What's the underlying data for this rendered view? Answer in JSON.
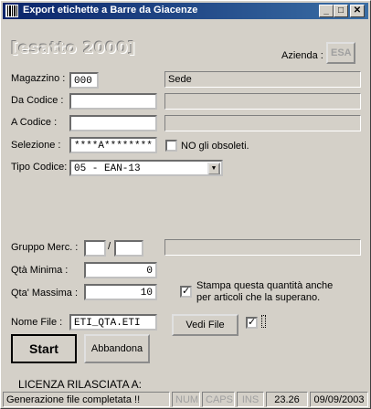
{
  "window": {
    "title": "Export etichette a Barre da Giacenze",
    "minimize_glyph": "_",
    "maximize_glyph": "□",
    "close_glyph": "✕"
  },
  "logo": {
    "text": "[esatto 2000]"
  },
  "company": {
    "label": "Azienda :",
    "value": "ESA"
  },
  "form": {
    "magazzino_label": "Magazzino :",
    "magazzino_value": "000",
    "magazzino_desc": "Sede",
    "da_codice_label": "Da Codice :",
    "da_codice_value": "",
    "a_codice_label": "A Codice :",
    "a_codice_value": "",
    "selezione_label": "Selezione :",
    "selezione_value": "****A********",
    "no_obsoleti_label": "NO gli obsoleti.",
    "no_obsoleti_checked": false,
    "tipo_codice_label": "Tipo Codice:",
    "tipo_codice_value": "05  -  EAN-13",
    "gruppo_label": "Gruppo Merc. :",
    "gruppo_sep": "/",
    "qta_min_label": "Qtà Minima :",
    "qta_min_value": "0",
    "qta_max_label": "Qta' Massima :",
    "qta_max_value": "10",
    "stampa_label": "Stampa questa quantità anche per articoli che la superano.",
    "stampa_checked": true,
    "nome_file_label": "Nome File :",
    "nome_file_value": "ETI_QTA.ETI",
    "vedi_file_label": "Vedi File",
    "vedi_checked": true
  },
  "buttons": {
    "start": "Start",
    "abbandona": "Abbandona"
  },
  "license": {
    "label": "LICENZA RILASCIATA A:"
  },
  "statusbar": {
    "message": "Generazione file completata !!",
    "num": "NUM",
    "caps": "CAPS",
    "ins": "INS",
    "time": "23.26",
    "date": "09/09/2003"
  },
  "colors": {
    "title_bar_start": "#0a246a",
    "title_bar_end": "#3a6ea5",
    "face": "#d4d0c8"
  }
}
